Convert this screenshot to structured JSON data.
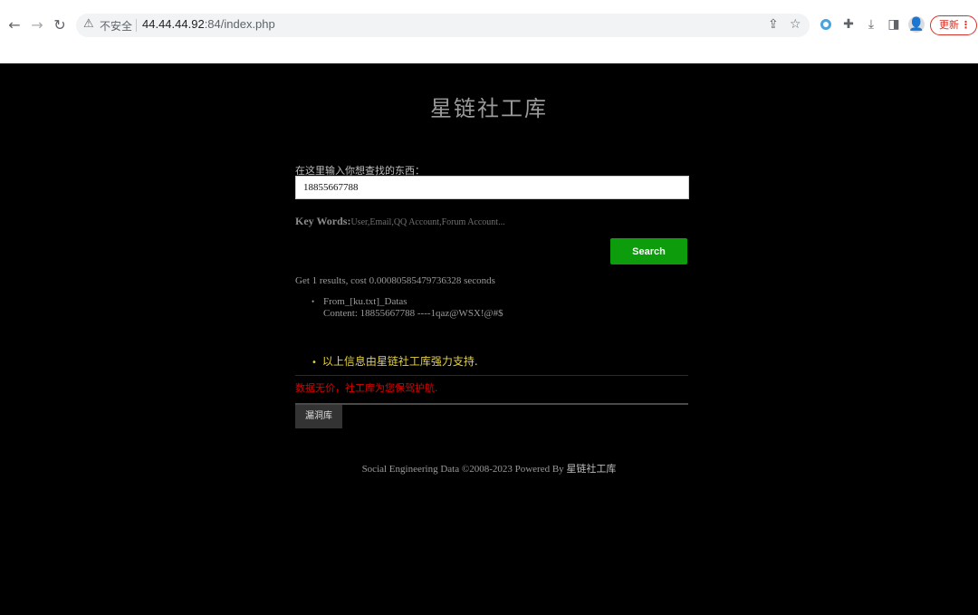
{
  "browser": {
    "back_icon": "arrow-left-icon",
    "forward_icon": "arrow-right-icon",
    "reload_icon": "reload-icon",
    "security_icon": "warning-triangle-icon",
    "security_label": "不安全",
    "url_host": "44.44.44.92",
    "url_path": ":84/index.php",
    "update_label": "更新",
    "accent_color": "#d93025"
  },
  "site": {
    "title": "星链社工库",
    "search_label": "在这里输入你想查找的东西：",
    "search_value": "18855667788",
    "keywords_title": "Key Words:",
    "keywords_list": "User,Email,QQ Account,Forum Account...",
    "search_button": "Search",
    "search_button_color": "#0c9c0c"
  },
  "results": {
    "summary": "Get 1 results,  cost 0.00080585479736328 seconds",
    "items": [
      {
        "source": "From_[ku.txt]_Datas",
        "content": "Content: 18855667788 ----1qaz@WSX!@#$"
      }
    ],
    "support": "以上信息由星链社工库强力支持."
  },
  "notice": "数据无价，社工库为您保驾护航.",
  "tab_label": "漏洞库",
  "footer": {
    "text": "Social Engineering Data ©2008-2023 Powered By ",
    "brand": "星链社工库"
  }
}
